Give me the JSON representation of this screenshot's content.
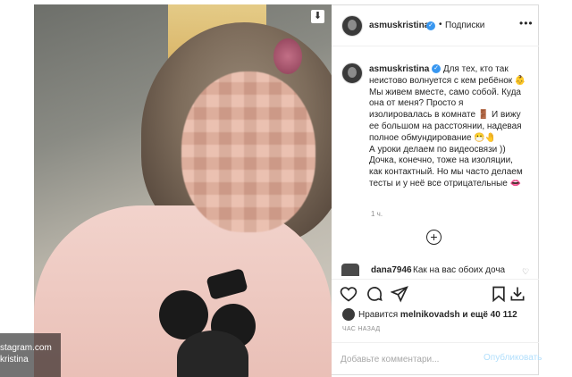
{
  "header": {
    "username": "asmuskristina",
    "dot": "•",
    "follow_label": "Подписки",
    "more": "•••"
  },
  "caption": {
    "username": "asmuskristina",
    "lines": [
      "Для тех, кто так неистово волнуется с кем ребёнок 👶",
      "Мы живем вместе, само собой. Куда она от меня? Просто я изолировалась в комнате 🚪 И вижу ее большом на расстоянии, надевая полное обмундирование 😷🤚",
      "А уроки делаем по видеосвязи ))",
      "Дочка, конечно, тоже на изоляции, как контактный. Но мы часто делаем тесты и у неё все отрицательные 👄"
    ]
  },
  "time_label": "1 ч.",
  "comment": {
    "username": "dana7946",
    "text": "Как на вас обоих доча"
  },
  "likes": {
    "prefix": "Нравится",
    "user": "melnikovadsh",
    "suffix": "и ещё 40 112"
  },
  "ago_label": "ЧАС НАЗАД",
  "add_comment": {
    "placeholder": "Добавьте комментари...",
    "post_label": "Опубликовать"
  },
  "watermark": {
    "line1": "stagram.com",
    "line2": "kristina"
  },
  "icons": {
    "download": "download-icon",
    "like": "heart-icon",
    "comment": "comment-icon",
    "share": "share-icon",
    "save": "bookmark-icon"
  }
}
